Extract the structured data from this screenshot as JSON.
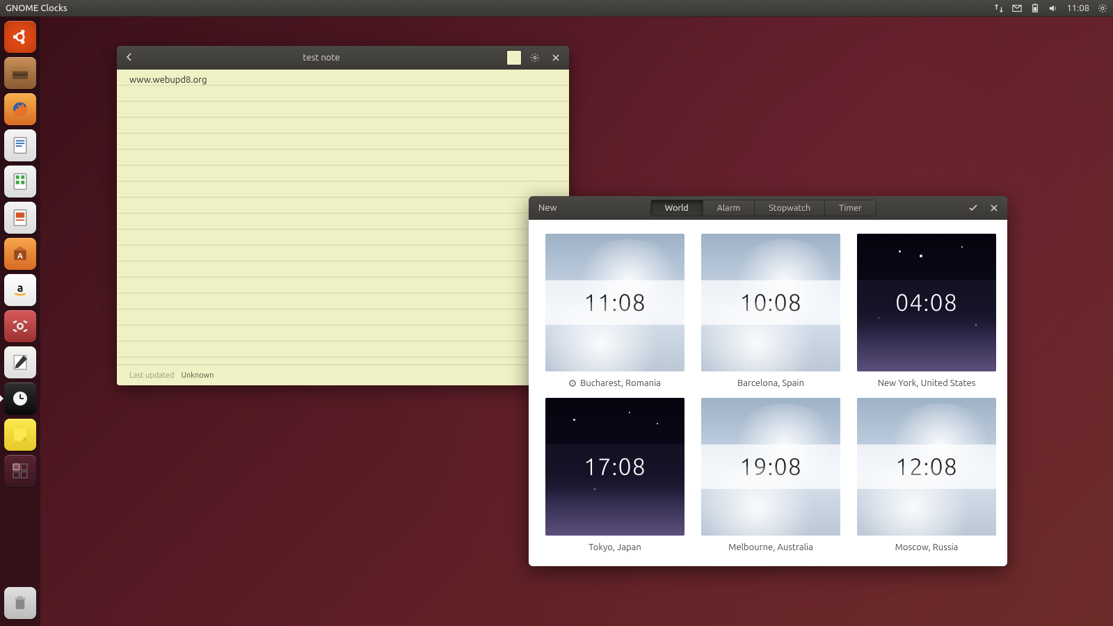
{
  "menubar": {
    "app_title": "GNOME Clocks",
    "time": "11:08"
  },
  "launcher": {
    "items": [
      {
        "name": "dash-icon",
        "color": "#5b2436"
      },
      {
        "name": "files-icon",
        "color": "#8b5a32"
      },
      {
        "name": "firefox-icon",
        "color": "#d96a24"
      },
      {
        "name": "writer-icon",
        "color": "#2a6fb9"
      },
      {
        "name": "calc-icon",
        "color": "#3fa648"
      },
      {
        "name": "impress-icon",
        "color": "#d15a2a"
      },
      {
        "name": "software-icon",
        "color": "#d96a24"
      },
      {
        "name": "amazon-icon",
        "color": "#f2f2f2"
      },
      {
        "name": "settings-icon",
        "color": "#b93c3c"
      },
      {
        "name": "notes-icon",
        "color": "#e6e6e6"
      },
      {
        "name": "clocks-icon",
        "color": "#1a1a1a"
      },
      {
        "name": "sticky-icon",
        "color": "#f5d33a"
      },
      {
        "name": "workspace-icon",
        "color": "#3a1620"
      }
    ],
    "trash": {
      "name": "trash-icon"
    }
  },
  "note": {
    "title": "test note",
    "content": "www.webupd8.org",
    "footer_label": "Last updated",
    "footer_value": "Unknown"
  },
  "clocks": {
    "new_label": "New",
    "select_tooltip": "Select",
    "tabs": [
      {
        "label": "World",
        "active": true
      },
      {
        "label": "Alarm",
        "active": false
      },
      {
        "label": "Stopwatch",
        "active": false
      },
      {
        "label": "Timer",
        "active": false
      }
    ],
    "cities": [
      {
        "time": "11:08",
        "label": "Bucharest, Romania",
        "phase": "day",
        "home": true
      },
      {
        "time": "10:08",
        "label": "Barcelona, Spain",
        "phase": "day",
        "home": false
      },
      {
        "time": "04:08",
        "label": "New York, United States",
        "phase": "night",
        "home": false
      },
      {
        "time": "17:08",
        "label": "Tokyo, Japan",
        "phase": "night",
        "home": false
      },
      {
        "time": "19:08",
        "label": "Melbourne, Australia",
        "phase": "day",
        "home": false
      },
      {
        "time": "12:08",
        "label": "Moscow, Russia",
        "phase": "day",
        "home": false
      }
    ]
  }
}
